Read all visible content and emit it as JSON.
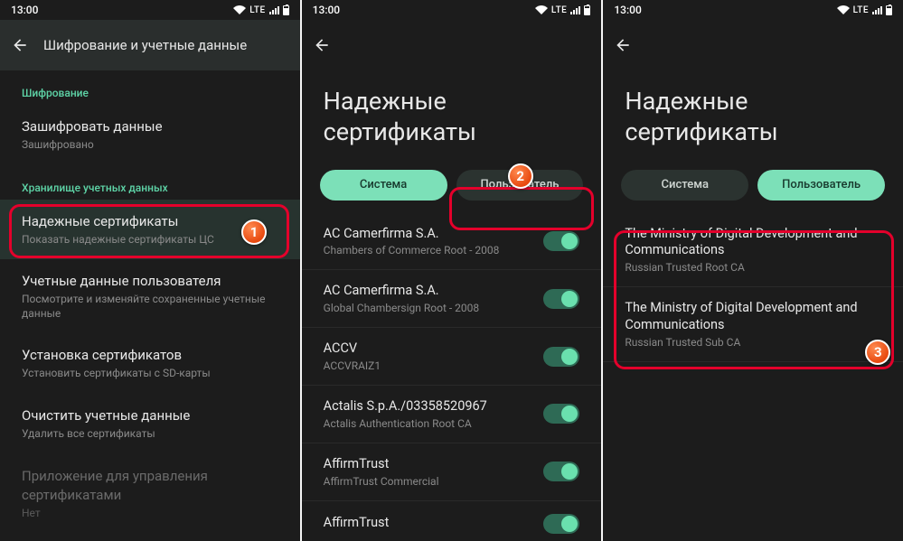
{
  "statusbar": {
    "time": "13:00",
    "network": "LTE"
  },
  "screen1": {
    "title": "Шифрование и учетные данные",
    "sections": {
      "encryption": {
        "label": "Шифрование",
        "item": {
          "title": "Зашифровать данные",
          "sub": "Зашифровано"
        }
      },
      "credstore": {
        "label": "Хранилище учетных данных",
        "items": [
          {
            "title": "Надежные сертификаты",
            "sub": "Показать надежные сертификаты ЦС"
          },
          {
            "title": "Учетные данные пользователя",
            "sub": "Посмотрите и изменяйте сохраненные учетные данные"
          },
          {
            "title": "Установка сертификатов",
            "sub": "Установить сертификаты с SD-карты"
          },
          {
            "title": "Очистить учетные данные",
            "sub": "Удалить все сертификаты"
          },
          {
            "title": "Приложение для управления сертификатами",
            "sub": "Нет"
          }
        ]
      }
    },
    "badge": "1"
  },
  "screen2": {
    "page_title": "Надежные сертификаты",
    "tabs": {
      "system": "Система",
      "user": "Пользователь"
    },
    "active_tab": "system",
    "certs": [
      {
        "title": "AC Camerfirma S.A.",
        "sub": "Chambers of Commerce Root - 2008"
      },
      {
        "title": "AC Camerfirma S.A.",
        "sub": "Global Chambersign Root - 2008"
      },
      {
        "title": "ACCV",
        "sub": "ACCVRAIZ1"
      },
      {
        "title": "Actalis S.p.A./03358520967",
        "sub": "Actalis Authentication Root CA"
      },
      {
        "title": "AffirmTrust",
        "sub": "AffirmTrust Commercial"
      },
      {
        "title": "AffirmTrust",
        "sub": ""
      }
    ],
    "badge": "2"
  },
  "screen3": {
    "page_title": "Надежные сертификаты",
    "tabs": {
      "system": "Система",
      "user": "Пользователь"
    },
    "active_tab": "user",
    "certs": [
      {
        "title": "The Ministry of Digital Development and Communications",
        "sub": "Russian Trusted Root CA"
      },
      {
        "title": "The Ministry of Digital Development and Communications",
        "sub": "Russian Trusted Sub CA"
      }
    ],
    "badge": "3"
  }
}
